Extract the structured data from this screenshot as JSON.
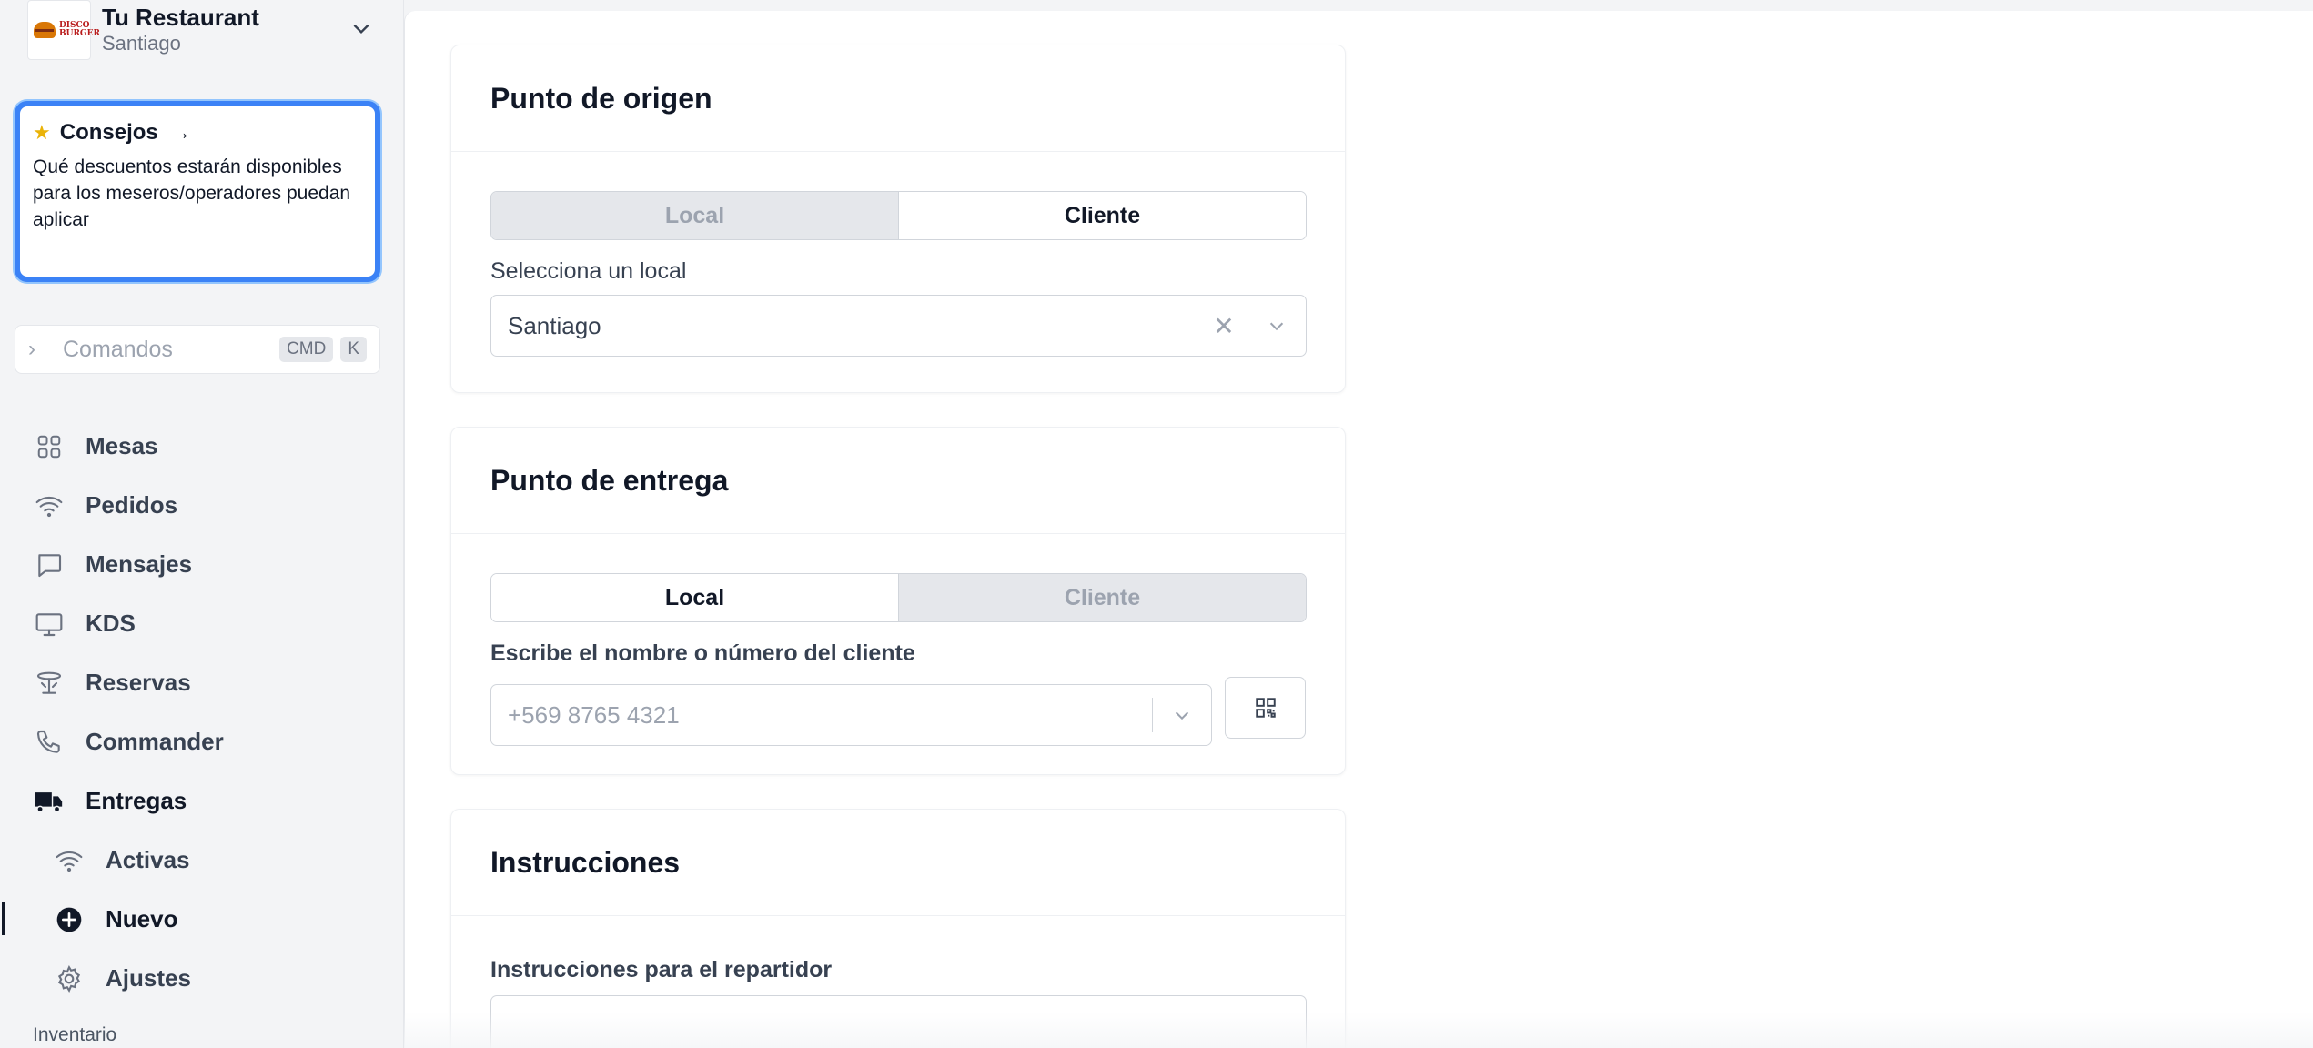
{
  "brand": {
    "name": "Tu Restaurant",
    "city": "Santiago",
    "logo_text": "DISCO BURGER"
  },
  "tips": {
    "title": "Consejos",
    "body": "Qué descuentos estarán disponibles para los meseros/operadores puedan aplicar"
  },
  "commands": {
    "label": "Comandos",
    "key1": "CMD",
    "key2": "K"
  },
  "nav": {
    "mesas": "Mesas",
    "pedidos": "Pedidos",
    "mensajes": "Mensajes",
    "kds": "KDS",
    "reservas": "Reservas",
    "commander": "Commander",
    "entregas": "Entregas",
    "activas": "Activas",
    "nuevo": "Nuevo",
    "ajustes": "Ajustes",
    "section_inventario": "Inventario"
  },
  "origin": {
    "title": "Punto de origen",
    "option_local": "Local",
    "option_cliente": "Cliente",
    "selected": "Cliente",
    "select_label": "Selecciona un local",
    "select_value": "Santiago"
  },
  "delivery": {
    "title": "Punto de entrega",
    "option_local": "Local",
    "option_cliente": "Cliente",
    "selected": "Local",
    "client_label": "Escribe el nombre o número del cliente",
    "client_placeholder": "+569 8765 4321"
  },
  "instructions": {
    "title": "Instrucciones",
    "field_label": "Instrucciones para el repartidor"
  },
  "colors": {
    "accent": "#3b82f6",
    "star": "#eab308"
  }
}
